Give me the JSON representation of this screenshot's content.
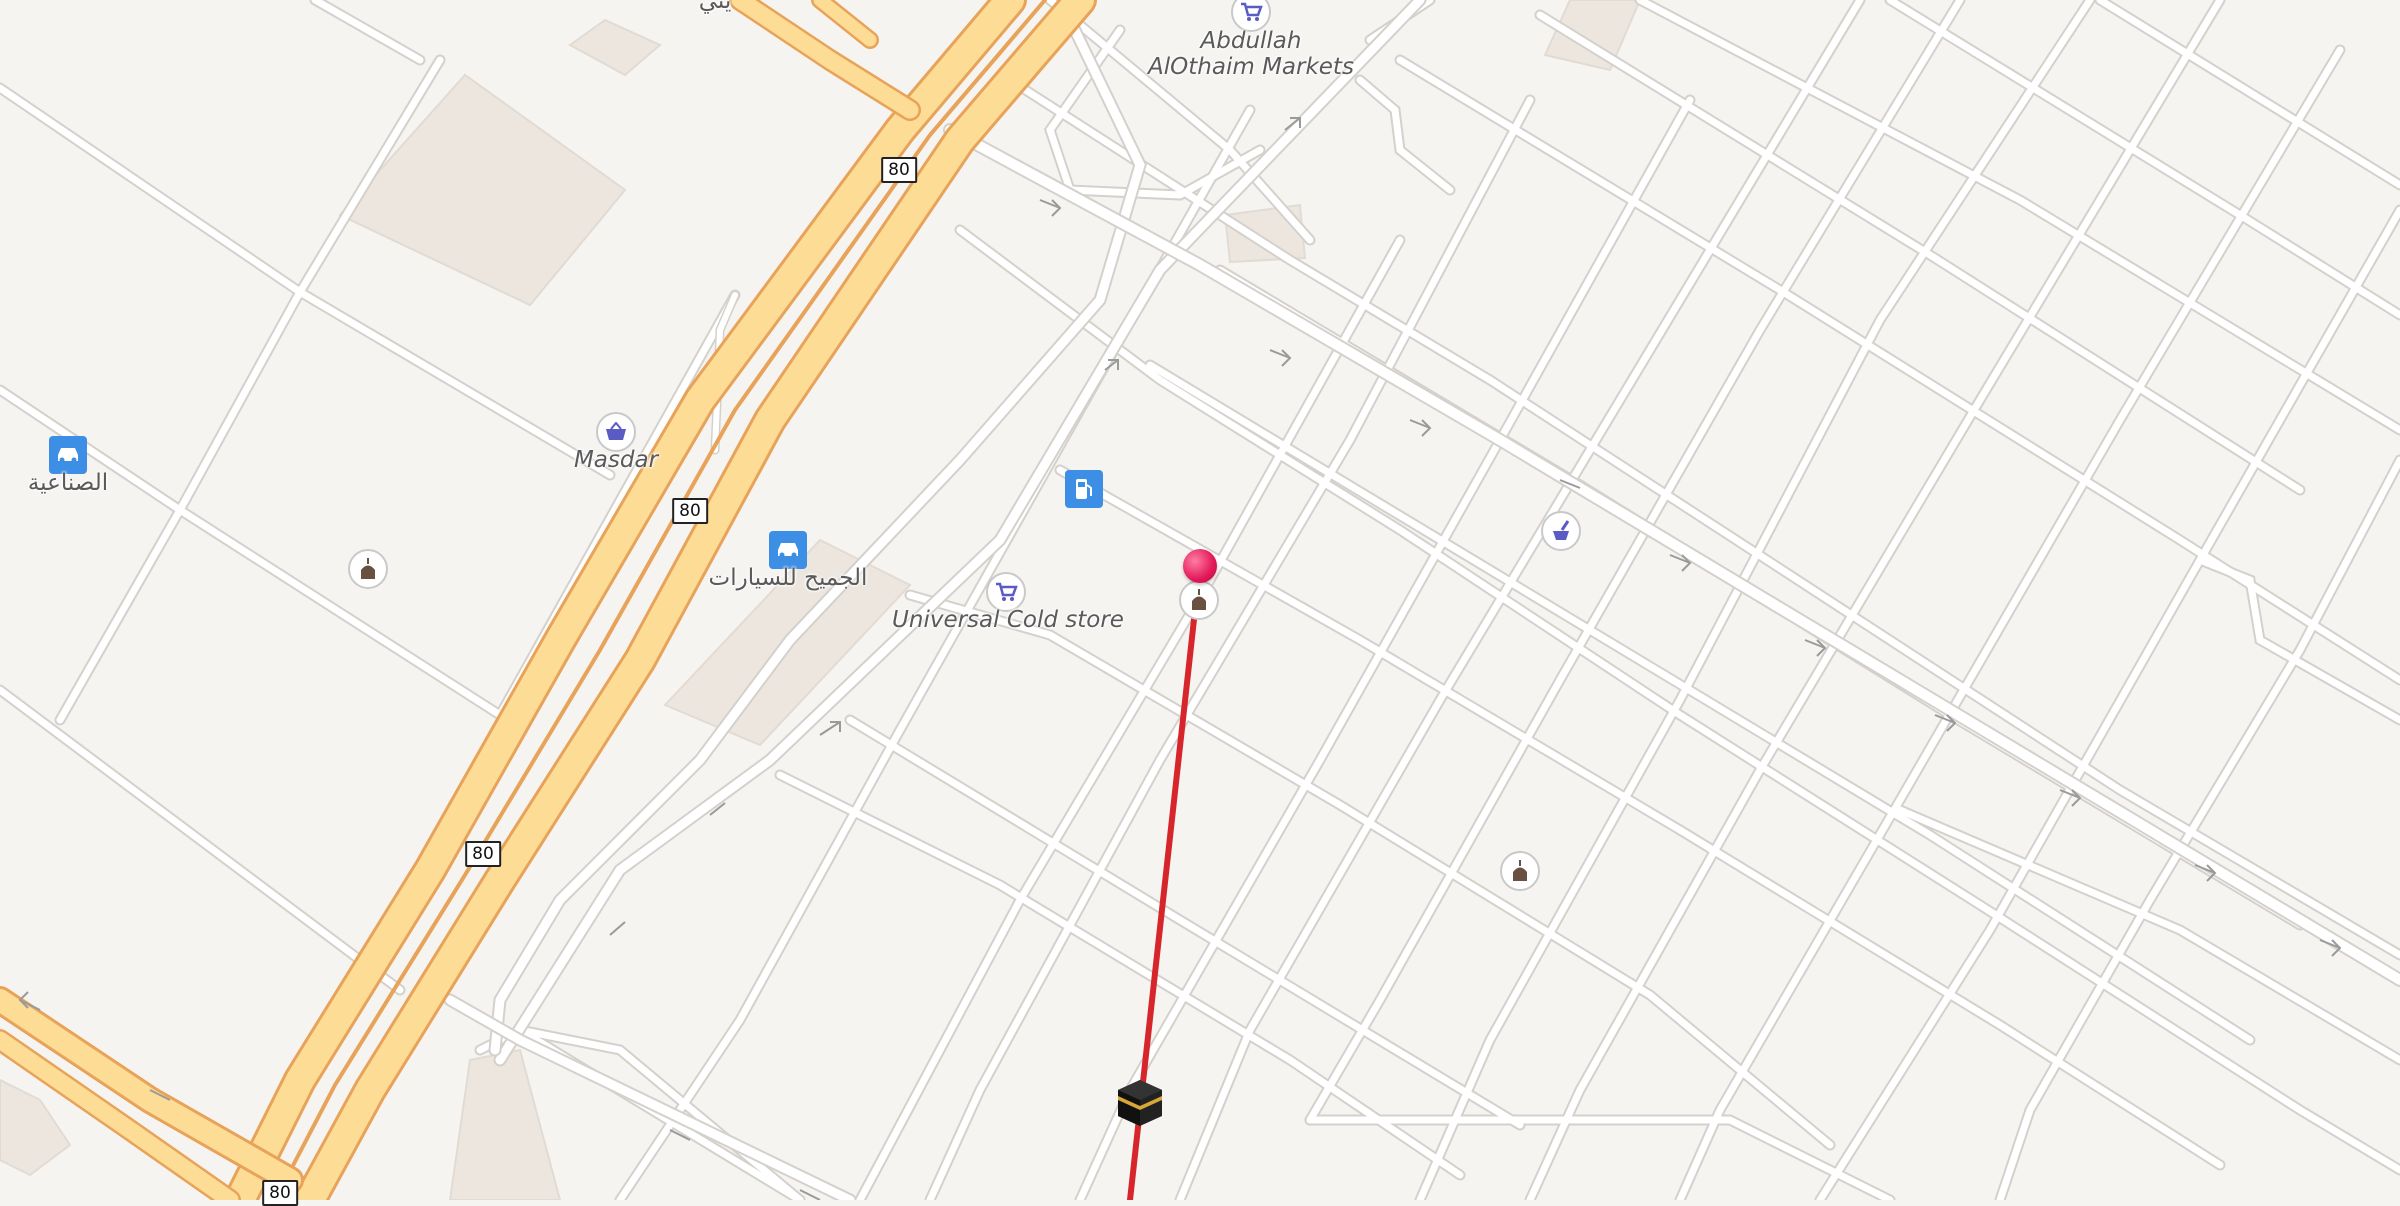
{
  "map": {
    "labels": {
      "othaim": "Abdullah AlOthaim Markets",
      "masdar": "Masdar",
      "sinaiya": "الصناعية",
      "jumaih": "الجميح للسيارات",
      "universal": "Universal Cold store",
      "top_arabic": "يني"
    },
    "route_shields": [
      "80",
      "80",
      "80",
      "80"
    ],
    "colors": {
      "background": "#f6f4f1",
      "road": "#ffffff",
      "road_casing": "#d4d1cc",
      "motorway_fill": "#fddc95",
      "motorway_casing": "#e8a35a",
      "building": "#ece6df",
      "qibla_line": "#d6262b",
      "pin": "#e21859",
      "poi_blue": "#3d8fe6",
      "poi_purple": "#5b5bc4"
    },
    "icons": {
      "car_dealer": "car-icon",
      "fuel": "fuel-pump-icon",
      "shop": "shopping-basket-icon",
      "cart": "shopping-cart-icon",
      "pharmacy": "mortar-pestle-icon",
      "mosque": "mosque-icon",
      "kaaba": "kaaba-icon",
      "location": "location-pin-icon"
    }
  }
}
